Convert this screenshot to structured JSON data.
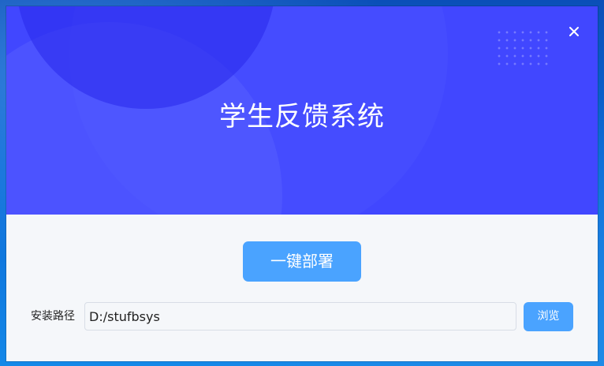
{
  "window": {
    "title": "学生反馈系统",
    "close_icon": "close-icon"
  },
  "main": {
    "deploy_label": "一键部署",
    "path_label": "安装路径",
    "path_value": "D:/stufbsys",
    "browse_label": "浏览"
  },
  "colors": {
    "banner": "#4147ff",
    "button": "#4aa3ff",
    "body": "#f5f7fa"
  }
}
